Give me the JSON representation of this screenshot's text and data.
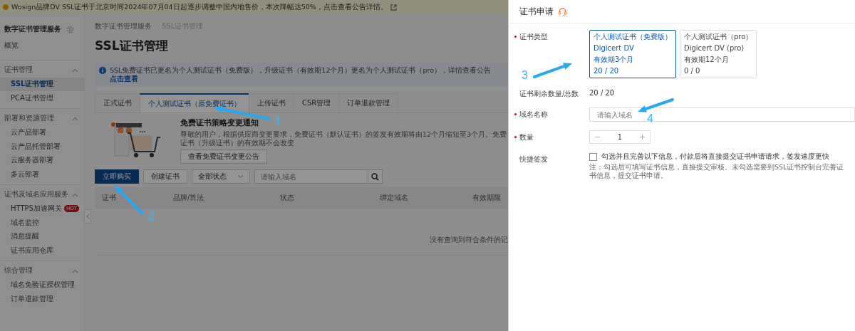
{
  "announcement": {
    "text": "Wosign品牌DV SSL证书于北京时间2024年07月04日起逐步调整中国内地售价，本次降幅达50%，点击查看公告详情。"
  },
  "sidebar": {
    "title": "数字证书管理服务",
    "items": [
      {
        "label": "概览",
        "selected": false
      }
    ],
    "groups": [
      {
        "title": "证书管理",
        "expanded": true,
        "items": [
          {
            "label": "SSL证书管理",
            "selected": true
          },
          {
            "label": "PCA证书管理",
            "selected": false
          }
        ]
      },
      {
        "title": "部署和资源管理",
        "expanded": true,
        "items": [
          {
            "label": "云产品部署",
            "selected": false
          },
          {
            "label": "云产品托管部署",
            "selected": false
          },
          {
            "label": "云服务器部署",
            "selected": false
          },
          {
            "label": "多云部署",
            "selected": false
          }
        ]
      },
      {
        "title": "证书及域名应用服务",
        "expanded": true,
        "items": [
          {
            "label": "HTTPS加速网关",
            "selected": false,
            "badge": "HOT"
          },
          {
            "label": "域名监控",
            "selected": false
          },
          {
            "label": "消息提醒",
            "selected": false
          },
          {
            "label": "证书应用仓库",
            "selected": false
          }
        ]
      },
      {
        "title": "综合管理",
        "expanded": true,
        "items": [
          {
            "label": "域名免验证授权管理",
            "selected": false
          },
          {
            "label": "订单退款管理",
            "selected": false
          }
        ]
      }
    ]
  },
  "breadcrumb": [
    "数字证书管理服务",
    "SSL证书管理"
  ],
  "page_title": "SSL证书管理",
  "notice": {
    "text": "SSL免费证书已更名为个人测试证书（免费版），升级证书（有效期12个月）更名为个人测试证书（pro），详情查看公告",
    "link": "点击查看"
  },
  "tabs": [
    {
      "label": "正式证书",
      "selected": false
    },
    {
      "label": "个人测试证书（原免费证书）",
      "selected": true
    },
    {
      "label": "上传证书",
      "selected": false
    },
    {
      "label": "CSR管理",
      "selected": false
    },
    {
      "label": "订单退款管理",
      "selected": false
    }
  ],
  "promo": {
    "title": "免费证书策略变更通知",
    "text": "尊敬的用户，根据供应商变更要求，免费证书（默认证书）的签发有效期将由12个月缩短至3个月。免费证书（升级证书）的有效期不会改变",
    "button": "查看免费证书变更公告"
  },
  "toolbar": {
    "primary_button": "立即购买",
    "secondary_button": "创建证书",
    "status_select": "全部状态",
    "search": {
      "placeholder": "请输入域名"
    }
  },
  "table": {
    "columns": [
      "证书",
      "品牌/算法",
      "状态",
      "绑定域名",
      "有效期限"
    ],
    "empty_text": "没有查询到符合条件的记"
  },
  "drawer": {
    "title": "证书申请",
    "fields": [
      {
        "kind": "cards",
        "label": "证书类型",
        "required": true,
        "options": [
          {
            "lines": [
              "个人测试证书（免费版）",
              "Digicert DV",
              "有效期3个月",
              "20 / 20"
            ],
            "selected": true
          },
          {
            "lines": [
              "个人测试证书（pro）",
              "Digicert DV (pro)",
              "有效期12个月",
              "0 / 0"
            ],
            "selected": false
          }
        ]
      },
      {
        "kind": "text",
        "label": "证书剩余数量/总数",
        "required": false,
        "value": "20 / 20"
      },
      {
        "kind": "input",
        "label": "域名名称",
        "required": true,
        "placeholder": "请输入域名"
      },
      {
        "kind": "stepper",
        "label": "数量",
        "required": true,
        "value": "1"
      },
      {
        "kind": "checkbox",
        "label": "快捷签发",
        "required": false,
        "checked": false,
        "text": "勾选并且完善以下信息，付款后将直接提交证书申请请求，签发速度更快",
        "note": "注：勾选后可填写证书信息，直接提交审核。未勾选需要到SSL证书控制台完善证书信息，提交证书申请。"
      }
    ]
  },
  "annotations": [
    {
      "label": "1"
    },
    {
      "label": "2"
    },
    {
      "label": "3"
    },
    {
      "label": "4"
    }
  ]
}
